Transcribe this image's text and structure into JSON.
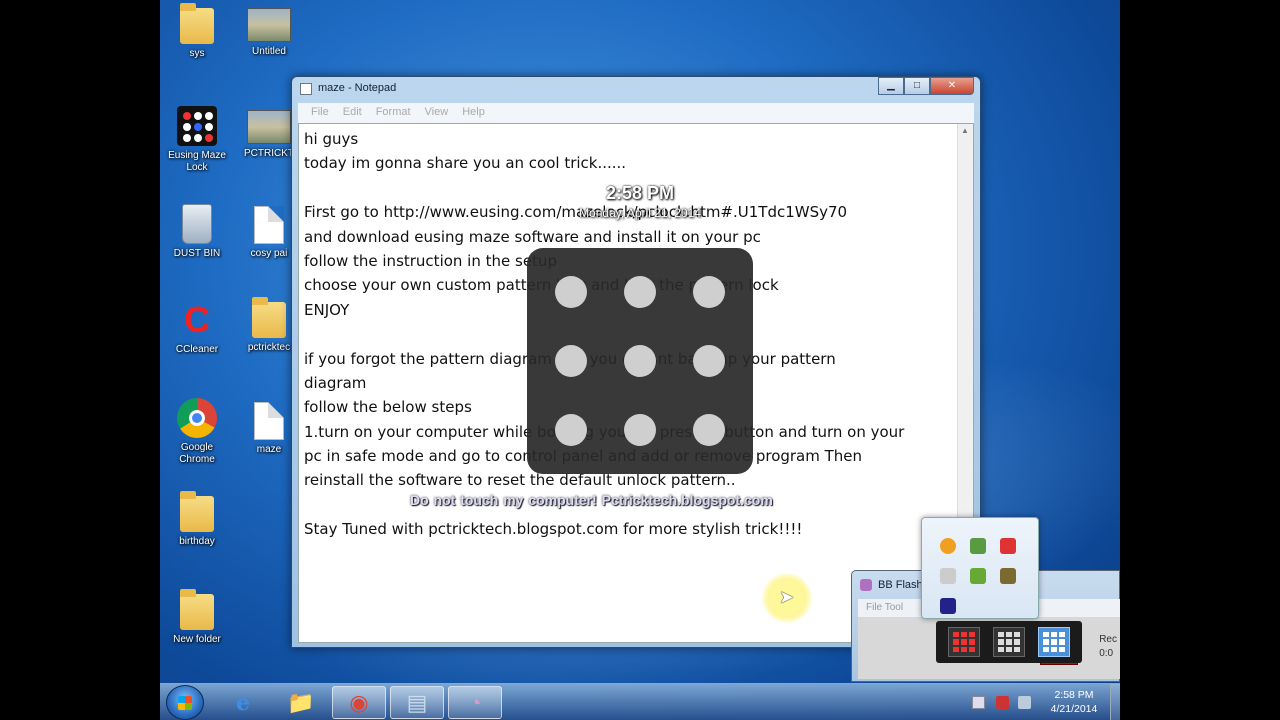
{
  "desktop": {
    "icons": [
      {
        "label": "sys"
      },
      {
        "label": "Untitled"
      },
      {
        "label": "Eusing Maze Lock"
      },
      {
        "label": "PCTRICKT"
      },
      {
        "label": "DUST BIN"
      },
      {
        "label": "cosy pai"
      },
      {
        "label": "CCleaner"
      },
      {
        "label": "pctricktec"
      },
      {
        "label": "Google Chrome"
      },
      {
        "label": "maze"
      },
      {
        "label": "birthday"
      },
      {
        "label": "New folder"
      }
    ]
  },
  "notepad": {
    "title": "maze - Notepad",
    "menu": [
      "File",
      "Edit",
      "Format",
      "View",
      "Help"
    ],
    "lines": [
      "hi guys",
      "today im gonna share you an cool trick......",
      "",
      "First go to http://www.eusing.com/mazelock/pclock.htm#.U1Tdc1WSy70",
      "and download eusing maze software and install it on your pc",
      "follow the instruction in the setup",
      "choose your own custom pattern lock and lock the pattern lock",
      "ENJOY",
      "",
      "if you forgot the pattern diagram and you doesnt back up your pattern",
      "diagram",
      "follow the below steps",
      "1.turn on your computer while booting your pc press f8 button and turn on your",
      "pc in safe mode and go to control panel and add or remove program Then",
      "reinstall the software to reset the default unlock pattern..",
      "",
      "Stay Tuned with pctricktech.blogspot.com for more stylish trick!!!!"
    ]
  },
  "lock_overlay": {
    "time": "2:58 PM",
    "date": "Monday, April 21, 2014",
    "watermark": "Do not touch my computer!     Pctricktech.blogspot.com"
  },
  "mini_window": {
    "title": "BB Flash",
    "menu": "File   Tool",
    "rec_label": "Rec",
    "rec_time": "0:0"
  },
  "taskbar": {
    "time": "2:58 PM",
    "date": "4/21/2014",
    "pinned": [
      {
        "name": "internet-explorer",
        "glyph": "e"
      },
      {
        "name": "file-explorer",
        "glyph": "📁"
      },
      {
        "name": "google-chrome",
        "glyph": "◉"
      },
      {
        "name": "notepad",
        "glyph": "▤"
      },
      {
        "name": "maze-lock",
        "glyph": "◔"
      }
    ]
  },
  "colors": {
    "desktop_blue": "#1f6cc4",
    "lock_pad": "#282828",
    "record_red": "#b01414",
    "cursor_highlight": "#fff08c"
  }
}
